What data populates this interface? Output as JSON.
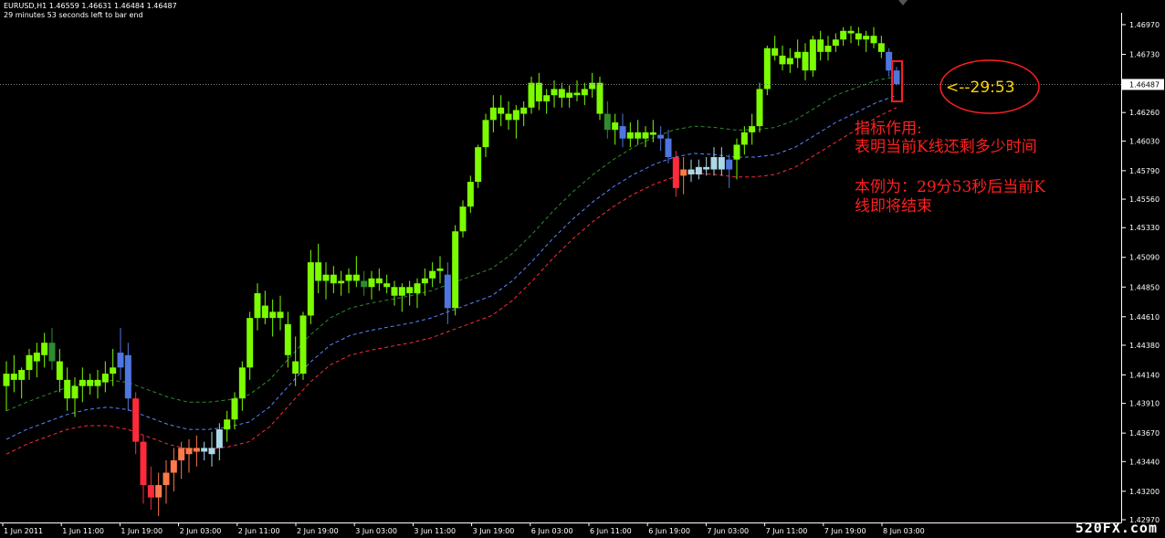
{
  "header": {
    "symbol_line": "EURUSD,H1  1.46559 1.46631 1.46484 1.46487",
    "timer_line": "29 minutes 53 seconds left to bar end"
  },
  "annotation": {
    "countdown": "<--29:53",
    "line1": "指标作用:",
    "line2": "表明当前K线还剩多少时间",
    "line3": "本例为：29分53秒后当前K",
    "line4": "线即将结束"
  },
  "watermark": "520FX.com",
  "colors": {
    "background": "#000000",
    "bull": "#7cfc00",
    "bull_dark": "#2e8b2e",
    "bear_red": "#ff2a3a",
    "bear_orange": "#ff7a4a",
    "blue": "#4f76e0",
    "light_blue": "#add8e6",
    "band_upper": "#2e8b2e",
    "band_middle": "#5a86ff",
    "band_lower": "#ff2a3a",
    "annotation": "#ff1f1f",
    "countdown": "#ffd400"
  },
  "chart_data": {
    "type": "candlestick",
    "symbol": "EURUSD",
    "timeframe": "H1",
    "ylim": [
      1.4297,
      1.4697
    ],
    "y_ticks": [
      "1.46970",
      "1.46730",
      "1.46487",
      "1.46260",
      "1.46030",
      "1.45790",
      "1.45560",
      "1.45330",
      "1.45090",
      "1.44850",
      "1.44610",
      "1.44380",
      "1.44140",
      "1.43910",
      "1.43670",
      "1.43440",
      "1.43200",
      "1.42970"
    ],
    "current_price": "1.46487",
    "x_ticks": [
      "1 Jun 2011",
      "1 Jun 11:00",
      "1 Jun 19:00",
      "2 Jun 03:00",
      "2 Jun 11:00",
      "2 Jun 19:00",
      "3 Jun 03:00",
      "3 Jun 11:00",
      "3 Jun 19:00",
      "6 Jun 03:00",
      "6 Jun 11:00",
      "6 Jun 19:00",
      "7 Jun 03:00",
      "7 Jun 11:00",
      "7 Jun 19:00",
      "8 Jun 03:00"
    ],
    "candles": [
      [
        1.4405,
        1.4425,
        1.4385,
        1.4415,
        "bull"
      ],
      [
        1.4415,
        1.443,
        1.44,
        1.441,
        "bull"
      ],
      [
        1.441,
        1.442,
        1.4395,
        1.4418,
        "bull"
      ],
      [
        1.4418,
        1.4435,
        1.441,
        1.443,
        "bull"
      ],
      [
        1.4425,
        1.444,
        1.4412,
        1.4432,
        "bull"
      ],
      [
        1.443,
        1.4448,
        1.442,
        1.444,
        "bull"
      ],
      [
        1.444,
        1.4452,
        1.4418,
        1.4425,
        "bulldark"
      ],
      [
        1.4425,
        1.4435,
        1.44,
        1.441,
        "bull"
      ],
      [
        1.441,
        1.442,
        1.4385,
        1.4395,
        "bull"
      ],
      [
        1.4395,
        1.4412,
        1.438,
        1.4405,
        "bull"
      ],
      [
        1.4405,
        1.442,
        1.4392,
        1.441,
        "bull"
      ],
      [
        1.441,
        1.4415,
        1.4398,
        1.4405,
        "bull"
      ],
      [
        1.4405,
        1.4418,
        1.4395,
        1.441,
        "bull"
      ],
      [
        1.4408,
        1.4425,
        1.44,
        1.4415,
        "bull"
      ],
      [
        1.4415,
        1.4435,
        1.4405,
        1.442,
        "bull"
      ],
      [
        1.442,
        1.4452,
        1.441,
        1.4432,
        "blue"
      ],
      [
        1.443,
        1.444,
        1.4385,
        1.4395,
        "blue"
      ],
      [
        1.4395,
        1.44,
        1.435,
        1.436,
        "red"
      ],
      [
        1.436,
        1.4365,
        1.431,
        1.4325,
        "red"
      ],
      [
        1.4325,
        1.434,
        1.4305,
        1.4315,
        "red"
      ],
      [
        1.4315,
        1.4335,
        1.43,
        1.4325,
        "orange"
      ],
      [
        1.4325,
        1.4345,
        1.431,
        1.4335,
        "orange"
      ],
      [
        1.4335,
        1.4355,
        1.432,
        1.4345,
        "orange"
      ],
      [
        1.4345,
        1.436,
        1.433,
        1.4355,
        "orange"
      ],
      [
        1.435,
        1.4362,
        1.4335,
        1.4355,
        "orange"
      ],
      [
        1.4355,
        1.4365,
        1.434,
        1.4352,
        "orange"
      ],
      [
        1.4352,
        1.436,
        1.4345,
        1.4355,
        "lightblue"
      ],
      [
        1.4355,
        1.4368,
        1.434,
        1.435,
        "lightblue"
      ],
      [
        1.4355,
        1.4375,
        1.4345,
        1.437,
        "lightblue"
      ],
      [
        1.437,
        1.4385,
        1.436,
        1.4378,
        "bull"
      ],
      [
        1.4378,
        1.44,
        1.437,
        1.4395,
        "bull"
      ],
      [
        1.4395,
        1.4425,
        1.4385,
        1.442,
        "bull"
      ],
      [
        1.442,
        1.4465,
        1.441,
        1.446,
        "bull"
      ],
      [
        1.446,
        1.4488,
        1.445,
        1.448,
        "bull"
      ],
      [
        1.447,
        1.4482,
        1.4455,
        1.446,
        "bull"
      ],
      [
        1.446,
        1.4475,
        1.4445,
        1.4465,
        "bull"
      ],
      [
        1.4465,
        1.4478,
        1.445,
        1.446,
        "bull"
      ],
      [
        1.4455,
        1.4465,
        1.442,
        1.443,
        "bull"
      ],
      [
        1.4425,
        1.4445,
        1.4405,
        1.4415,
        "bull"
      ],
      [
        1.4415,
        1.4465,
        1.441,
        1.4462,
        "bull"
      ],
      [
        1.4462,
        1.4515,
        1.4455,
        1.4505,
        "bull"
      ],
      [
        1.4505,
        1.452,
        1.448,
        1.449,
        "bull"
      ],
      [
        1.449,
        1.4505,
        1.4475,
        1.4495,
        "bull"
      ],
      [
        1.4495,
        1.4502,
        1.448,
        1.4488,
        "bull"
      ],
      [
        1.4488,
        1.4498,
        1.4478,
        1.449,
        "bull"
      ],
      [
        1.449,
        1.45,
        1.448,
        1.4495,
        "bull"
      ],
      [
        1.4495,
        1.451,
        1.4485,
        1.449,
        "bull"
      ],
      [
        1.449,
        1.4498,
        1.4478,
        1.4485,
        "bulldark"
      ],
      [
        1.4485,
        1.4498,
        1.4475,
        1.4492,
        "bull"
      ],
      [
        1.4492,
        1.45,
        1.4482,
        1.4488,
        "bull"
      ],
      [
        1.4488,
        1.4495,
        1.448,
        1.4485,
        "bull"
      ],
      [
        1.4485,
        1.449,
        1.447,
        1.4478,
        "bull"
      ],
      [
        1.4478,
        1.4488,
        1.4465,
        1.4485,
        "bull"
      ],
      [
        1.4485,
        1.449,
        1.447,
        1.448,
        "bull"
      ],
      [
        1.448,
        1.4492,
        1.4468,
        1.4488,
        "bull"
      ],
      [
        1.4488,
        1.45,
        1.4478,
        1.4492,
        "bull"
      ],
      [
        1.4492,
        1.4505,
        1.4485,
        1.4498,
        "bull"
      ],
      [
        1.4498,
        1.451,
        1.4488,
        1.45,
        "bull"
      ],
      [
        1.4495,
        1.4505,
        1.4455,
        1.4468,
        "blue"
      ],
      [
        1.4468,
        1.4535,
        1.4462,
        1.453,
        "bull"
      ],
      [
        1.453,
        1.4555,
        1.4525,
        1.455,
        "bull"
      ],
      [
        1.455,
        1.4575,
        1.4545,
        1.457,
        "bull"
      ],
      [
        1.457,
        1.46,
        1.4565,
        1.4598,
        "bull"
      ],
      [
        1.4598,
        1.4625,
        1.459,
        1.462,
        "bull"
      ],
      [
        1.462,
        1.464,
        1.461,
        1.463,
        "bull"
      ],
      [
        1.463,
        1.464,
        1.4615,
        1.4625,
        "bull"
      ],
      [
        1.4625,
        1.4635,
        1.4612,
        1.462,
        "bull"
      ],
      [
        1.462,
        1.4632,
        1.4605,
        1.4628,
        "bull"
      ],
      [
        1.4625,
        1.4635,
        1.4615,
        1.463,
        "bull"
      ],
      [
        1.463,
        1.4655,
        1.4625,
        1.465,
        "bull"
      ],
      [
        1.465,
        1.4658,
        1.4628,
        1.4635,
        "bull"
      ],
      [
        1.4635,
        1.4645,
        1.4625,
        1.464,
        "bull"
      ],
      [
        1.464,
        1.4652,
        1.463,
        1.4645,
        "bull"
      ],
      [
        1.4645,
        1.465,
        1.463,
        1.4638,
        "bull"
      ],
      [
        1.4638,
        1.4648,
        1.463,
        1.4642,
        "bull"
      ],
      [
        1.4642,
        1.4652,
        1.4635,
        1.464,
        "bull"
      ],
      [
        1.464,
        1.465,
        1.4632,
        1.4645,
        "bull"
      ],
      [
        1.4645,
        1.4658,
        1.4638,
        1.465,
        "bull"
      ],
      [
        1.465,
        1.4655,
        1.462,
        1.4625,
        "bull"
      ],
      [
        1.4625,
        1.4635,
        1.4605,
        1.4612,
        "bulldark"
      ],
      [
        1.4612,
        1.4625,
        1.46,
        1.4618,
        "bull"
      ],
      [
        1.4615,
        1.4625,
        1.4598,
        1.4605,
        "blue"
      ],
      [
        1.4605,
        1.4618,
        1.4598,
        1.461,
        "bull"
      ],
      [
        1.461,
        1.462,
        1.46,
        1.4605,
        "bull"
      ],
      [
        1.4605,
        1.4615,
        1.4598,
        1.461,
        "bull"
      ],
      [
        1.461,
        1.462,
        1.4602,
        1.4608,
        "bull"
      ],
      [
        1.4608,
        1.4615,
        1.4595,
        1.4605,
        "blue"
      ],
      [
        1.4605,
        1.4612,
        1.4585,
        1.459,
        "blue"
      ],
      [
        1.459,
        1.4595,
        1.4558,
        1.4565,
        "red"
      ],
      [
        1.4575,
        1.459,
        1.456,
        1.458,
        "orange"
      ],
      [
        1.458,
        1.4588,
        1.457,
        1.4576,
        "lightblue"
      ],
      [
        1.4576,
        1.4588,
        1.4572,
        1.4582,
        "lightblue"
      ],
      [
        1.4582,
        1.459,
        1.4575,
        1.458,
        "lightblue"
      ],
      [
        1.458,
        1.4598,
        1.4575,
        1.459,
        "lightblue"
      ],
      [
        1.459,
        1.4598,
        1.4575,
        1.458,
        "lightblue"
      ],
      [
        1.458,
        1.4592,
        1.4565,
        1.4588,
        "blue"
      ],
      [
        1.4588,
        1.4605,
        1.4572,
        1.46,
        "bull"
      ],
      [
        1.46,
        1.4615,
        1.4592,
        1.461,
        "bull"
      ],
      [
        1.461,
        1.4625,
        1.46,
        1.4615,
        "bull"
      ],
      [
        1.4615,
        1.465,
        1.461,
        1.4645,
        "bull"
      ],
      [
        1.4645,
        1.468,
        1.464,
        1.4678,
        "bull"
      ],
      [
        1.4678,
        1.4688,
        1.4668,
        1.4672,
        "bull"
      ],
      [
        1.4672,
        1.468,
        1.466,
        1.4665,
        "bull"
      ],
      [
        1.4665,
        1.4678,
        1.4658,
        1.467,
        "bull"
      ],
      [
        1.467,
        1.4685,
        1.4662,
        1.4675,
        "bull"
      ],
      [
        1.4675,
        1.4682,
        1.4652,
        1.466,
        "bull"
      ],
      [
        1.466,
        1.4688,
        1.4655,
        1.4685,
        "bull"
      ],
      [
        1.4685,
        1.4692,
        1.4668,
        1.4675,
        "bull"
      ],
      [
        1.4675,
        1.4688,
        1.4668,
        1.468,
        "bull"
      ],
      [
        1.468,
        1.469,
        1.4675,
        1.4685,
        "bull"
      ],
      [
        1.4685,
        1.4695,
        1.468,
        1.4692,
        "bull"
      ],
      [
        1.4692,
        1.4696,
        1.4682,
        1.469,
        "bull"
      ],
      [
        1.469,
        1.4695,
        1.468,
        1.4685,
        "bull"
      ],
      [
        1.4685,
        1.4692,
        1.4675,
        1.4688,
        "bull"
      ],
      [
        1.4688,
        1.4695,
        1.4678,
        1.4682,
        "bull"
      ],
      [
        1.4682,
        1.4688,
        1.467,
        1.4675,
        "bull"
      ],
      [
        1.4675,
        1.4678,
        1.4655,
        1.466,
        "blue"
      ],
      [
        1.466,
        1.4663,
        1.4648,
        1.4649,
        "blue"
      ]
    ],
    "bands": {
      "upper": [
        1.4385,
        1.4392,
        1.4398,
        1.4404,
        1.4408,
        1.441,
        1.4408,
        1.4402,
        1.4396,
        1.4392,
        1.4392,
        1.4394,
        1.4398,
        1.441,
        1.4428,
        1.4446,
        1.446,
        1.4468,
        1.4472,
        1.4475,
        1.4478,
        1.4482,
        1.4488,
        1.4494,
        1.45,
        1.4512,
        1.4528,
        1.4546,
        1.4562,
        1.4576,
        1.4588,
        1.4598,
        1.4606,
        1.4612,
        1.4615,
        1.4614,
        1.4612,
        1.4612,
        1.4614,
        1.462,
        1.463,
        1.464,
        1.4646,
        1.4652,
        1.4655
      ],
      "middle": [
        1.4362,
        1.437,
        1.4376,
        1.4382,
        1.4386,
        1.4388,
        1.4386,
        1.438,
        1.4374,
        1.437,
        1.437,
        1.4372,
        1.4376,
        1.4388,
        1.4406,
        1.4424,
        1.4438,
        1.4446,
        1.445,
        1.4453,
        1.4456,
        1.446,
        1.4466,
        1.4472,
        1.4478,
        1.449,
        1.4506,
        1.4524,
        1.454,
        1.4554,
        1.4566,
        1.4576,
        1.4584,
        1.459,
        1.4593,
        1.4592,
        1.459,
        1.459,
        1.4592,
        1.4598,
        1.4608,
        1.4618,
        1.4626,
        1.4634,
        1.464
      ],
      "lower": [
        1.435,
        1.4358,
        1.4364,
        1.437,
        1.4373,
        1.4373,
        1.437,
        1.4364,
        1.4358,
        1.4354,
        1.4354,
        1.4356,
        1.436,
        1.4372,
        1.439,
        1.4408,
        1.4422,
        1.443,
        1.4434,
        1.4437,
        1.444,
        1.4444,
        1.445,
        1.4456,
        1.4462,
        1.4474,
        1.449,
        1.4508,
        1.4524,
        1.4538,
        1.455,
        1.456,
        1.4568,
        1.4574,
        1.4577,
        1.4576,
        1.4574,
        1.4574,
        1.4576,
        1.4582,
        1.4592,
        1.4602,
        1.4612,
        1.4622,
        1.463
      ]
    },
    "title": "",
    "xlabel": "",
    "ylabel": "",
    "grid": false,
    "legend": "none"
  }
}
